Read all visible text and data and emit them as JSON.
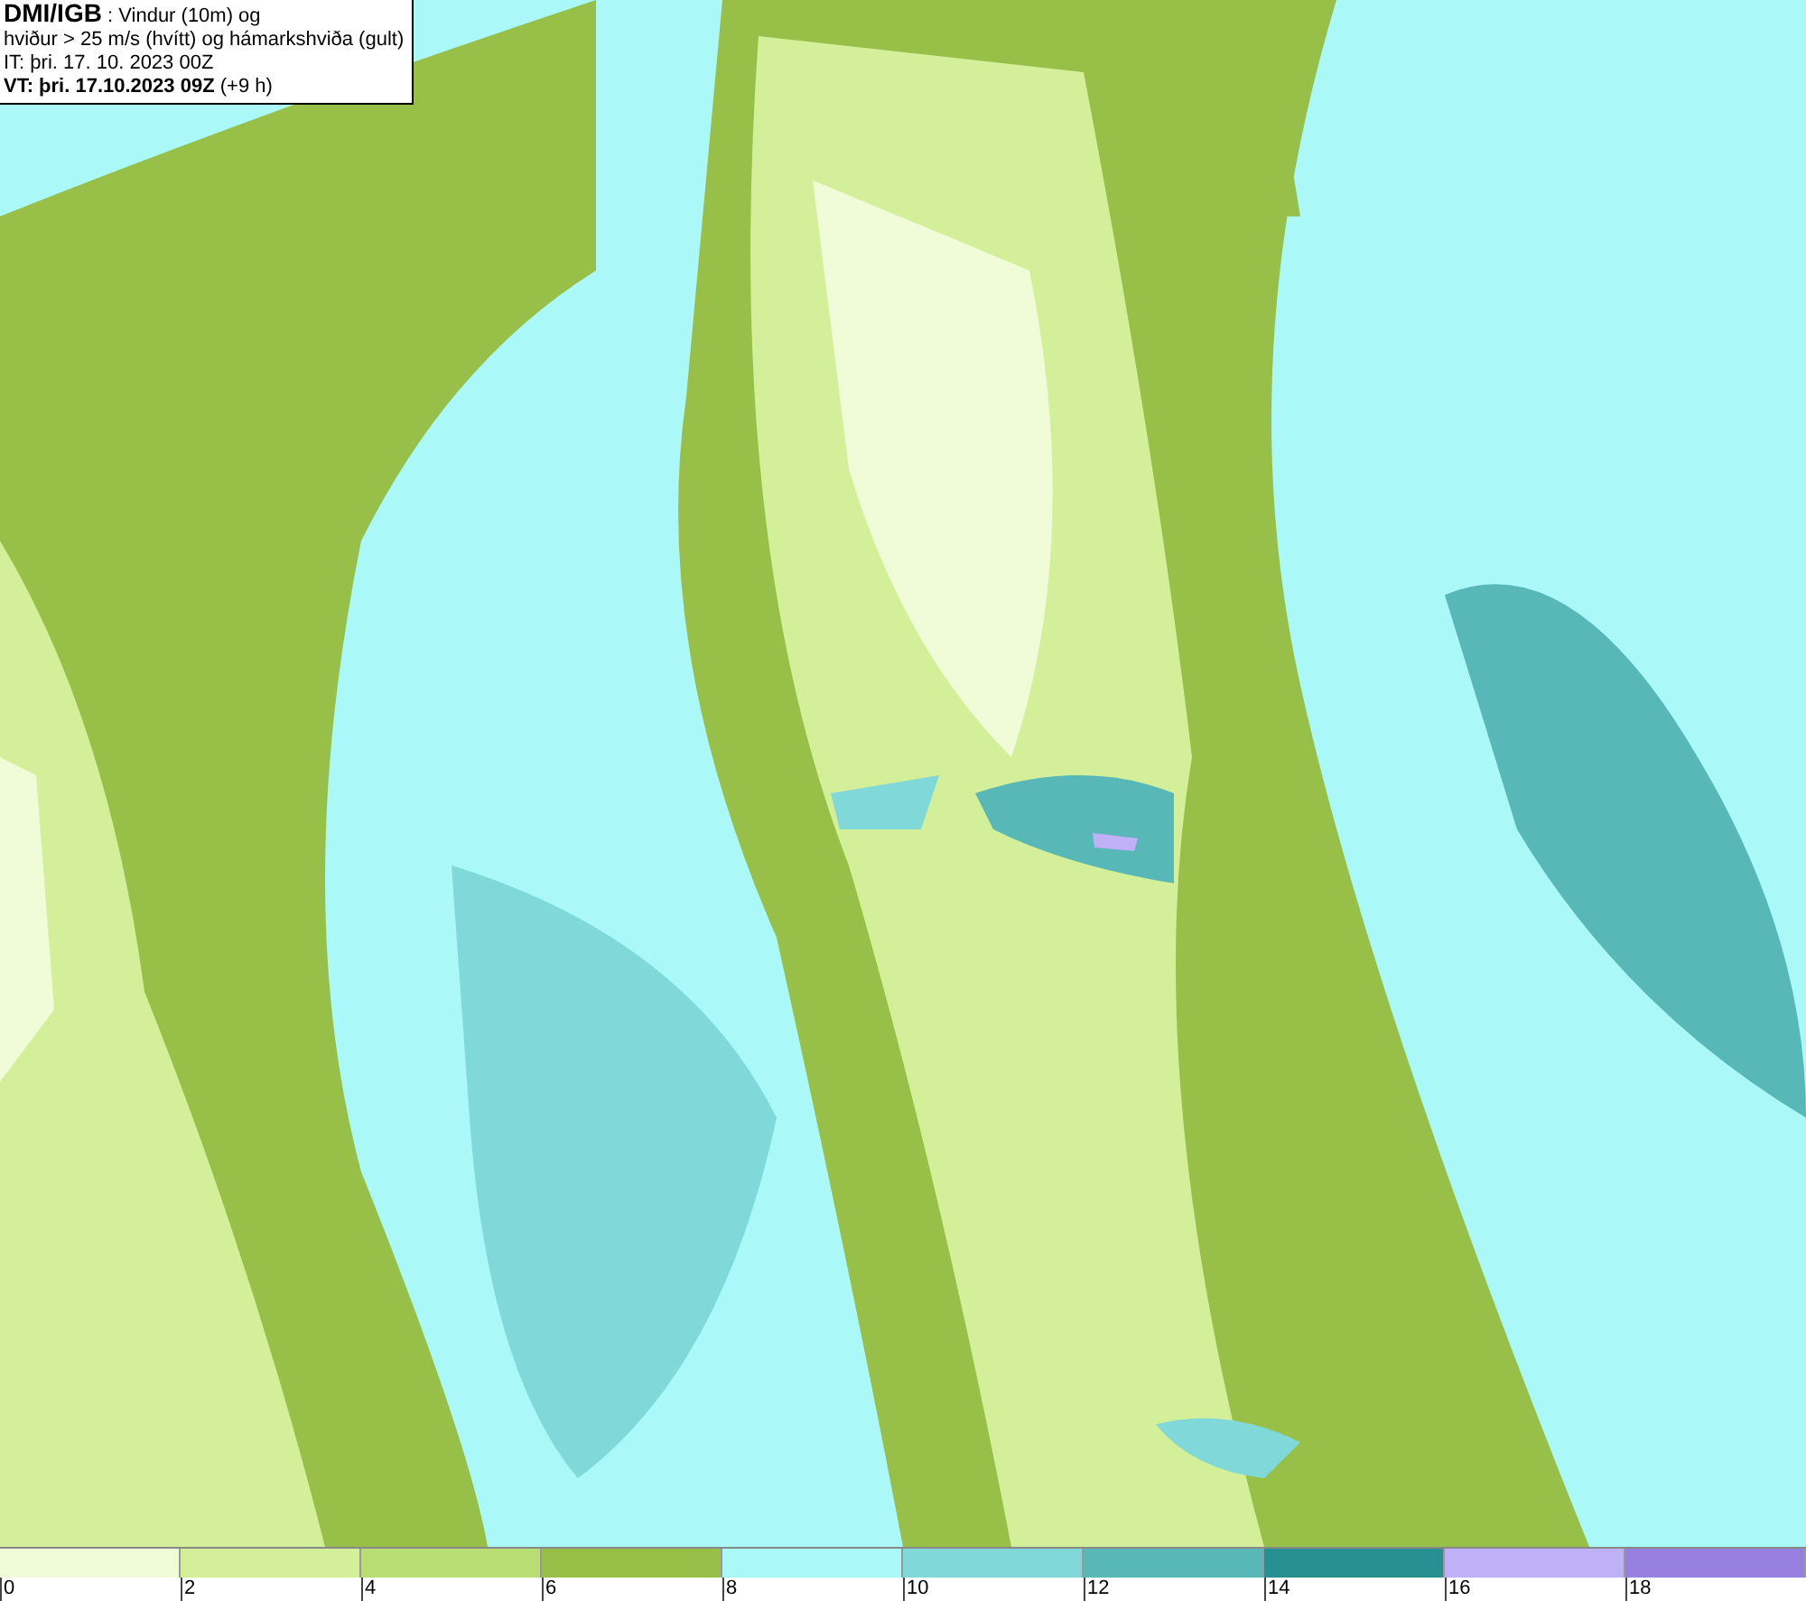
{
  "header": {
    "lines": [
      "**DMI/IGB** : Vindur (10m) og",
      "hviður > 25 m/s (hvítt) og hámarkshviða (gult)",
      "IT: þri. 17. 10. 2023 00Z",
      "**VT: þri. 17.10.2023 09Z** (+9 h)"
    ]
  },
  "legend": {
    "bins": [
      {
        "color": "#f0fcd8",
        "label": "0"
      },
      {
        "color": "#d4ef9a",
        "label": "2"
      },
      {
        "color": "#b8dd72",
        "label": "4"
      },
      {
        "color": "#98bf48",
        "label": "6"
      },
      {
        "color": "#aaf8f8",
        "label": "8"
      },
      {
        "color": "#80d8d8",
        "label": "10"
      },
      {
        "color": "#58b8b8",
        "label": "12"
      },
      {
        "color": "#289090",
        "label": "14"
      },
      {
        "color": "#c0b0f8",
        "label": "16"
      },
      {
        "color": "#9880e0",
        "label": "18"
      }
    ]
  }
}
